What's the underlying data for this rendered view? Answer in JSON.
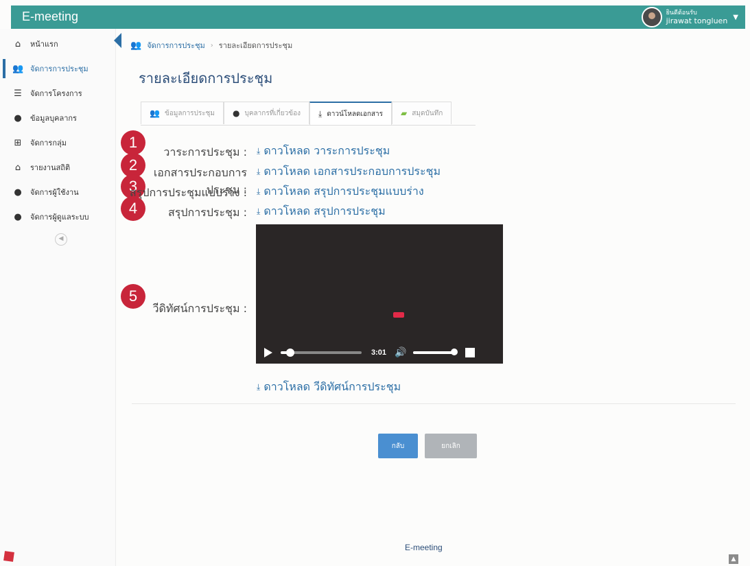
{
  "app": {
    "title": "E-meeting",
    "user_greeting": "ยินดีต้อนรับ",
    "user_name": "jirawat tongluen"
  },
  "sidebar": {
    "items": [
      {
        "label": "หน้าแรก",
        "icon": "home-icon"
      },
      {
        "label": "จัดการการประชุม",
        "icon": "users-icon"
      },
      {
        "label": "จัดการโครงการ",
        "icon": "list-icon"
      },
      {
        "label": "ข้อมูลบุคลากร",
        "icon": "user-icon"
      },
      {
        "label": "จัดการกลุ่ม",
        "icon": "plus-square-icon"
      },
      {
        "label": "รายงานสถิติ",
        "icon": "home-icon"
      },
      {
        "label": "จัดการผู้ใช้งาน",
        "icon": "user-icon"
      },
      {
        "label": "จัดการผู้ดูแลระบบ",
        "icon": "user-icon"
      }
    ]
  },
  "breadcrumb": {
    "root": "จัดการการประชุม",
    "current": "รายละเอียดการประชุม"
  },
  "page_title": "รายละเอียดการประชุม",
  "tabs": [
    {
      "label": "ข้อมูลการประชุม",
      "icon": "users-icon",
      "color": "#e8626f"
    },
    {
      "label": "บุคลากรที่เกี่ยวข้อง",
      "icon": "user-icon",
      "color": "#333333"
    },
    {
      "label": "ดาวน์โหลดเอกสาร",
      "icon": "download-icon",
      "color": "#333333"
    },
    {
      "label": "สมุดบันทึก",
      "icon": "book-icon",
      "color": "#7fbf45"
    }
  ],
  "documents": [
    {
      "number": "1",
      "label": "วาระการประชุม :",
      "link": "ดาวโหลด วาระการประชุม"
    },
    {
      "number": "2",
      "label": "เอกสารประกอบการประชุม :",
      "link": "ดาวโหลด เอกสารประกอบการประชุม"
    },
    {
      "number": "3",
      "label": "สรุปการประชุมแบบร่าง :",
      "link": "ดาวโหลด สรุปการประชุมแบบร่าง"
    },
    {
      "number": "4",
      "label": "สรุปการประชุม :",
      "link": "ดาวโหลด สรุปการประชุม"
    }
  ],
  "video": {
    "number": "5",
    "label": "วีดิทัศน์การประชุม :",
    "time": "3:01",
    "progress": 0.12,
    "volume": 1.0,
    "download_link": "ดาวโหลด วีดิทัศน์การประชุม"
  },
  "buttons": {
    "back": "กลับ",
    "cancel": "ยกเลิก"
  },
  "footer": {
    "text": "E-meeting"
  },
  "colors": {
    "header": "#3a9b95",
    "accent": "#2b6ea5",
    "badge": "#c8253a",
    "back_button": "#4a8fd1",
    "cancel_button": "#b0b4b8"
  }
}
